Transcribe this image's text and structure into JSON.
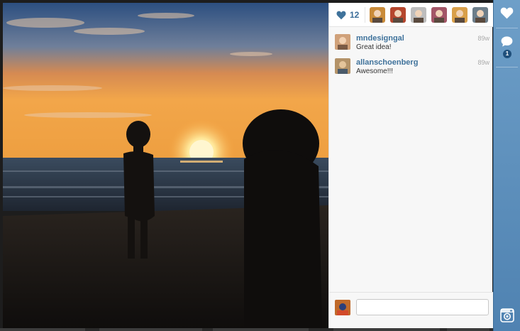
{
  "likes": {
    "count": "12"
  },
  "likers": [
    {
      "name": "liker-1",
      "color": "#c98b3a"
    },
    {
      "name": "liker-2",
      "color": "#b5462d"
    },
    {
      "name": "liker-3",
      "color": "#bdbdbd"
    },
    {
      "name": "liker-4",
      "color": "#a35667"
    },
    {
      "name": "liker-5",
      "color": "#d9a04a"
    },
    {
      "name": "liker-6",
      "color": "#6d7e8a"
    },
    {
      "name": "liker-7",
      "color": "#8b8b8b"
    }
  ],
  "comments": [
    {
      "user": "mndesigngal",
      "time": "89w",
      "text": "Great idea!",
      "avatar_color": "#d0a17a"
    },
    {
      "user": "allanschoenberg",
      "time": "89w",
      "text": "Awesome!!!",
      "avatar_color": "#b49369"
    }
  ],
  "composer": {
    "placeholder": "",
    "avatar_color": "#c06a2a"
  },
  "rail": {
    "comment_badge": "1"
  },
  "icons": {
    "like": "heart-icon",
    "rail_like": "heart-icon",
    "rail_comment": "speech-bubble-icon",
    "camera": "instagram-camera-icon"
  },
  "colors": {
    "accent_blue": "#3f729b",
    "rail_top": "#6e9fc8",
    "rail_bottom": "#4f82b1"
  }
}
